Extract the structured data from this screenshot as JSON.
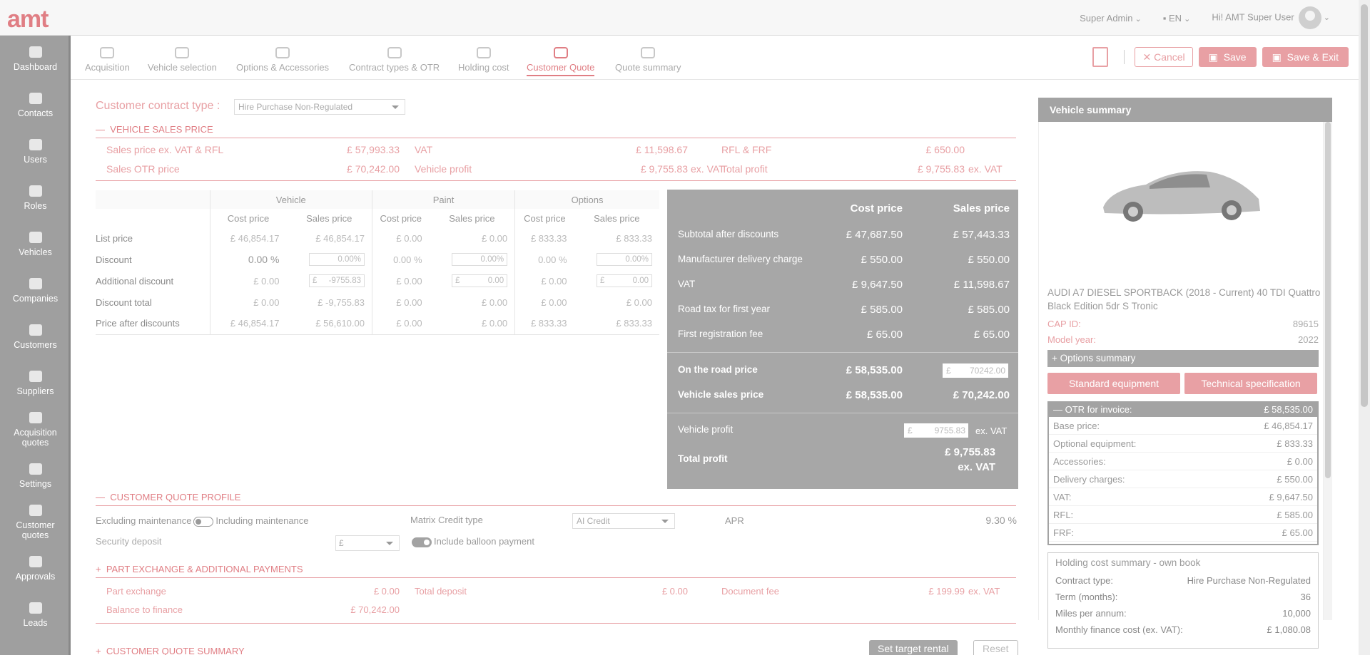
{
  "app": {
    "logo": "amt"
  },
  "topbar": {
    "role": "Super Admin",
    "lang": "EN",
    "greeting": "Hi! AMT Super User"
  },
  "sidebar": [
    {
      "label": "Dashboard",
      "icon": "dashboard-icon"
    },
    {
      "label": "Contacts",
      "icon": "contacts-icon"
    },
    {
      "label": "Users",
      "icon": "users-icon"
    },
    {
      "label": "Roles",
      "icon": "roles-icon"
    },
    {
      "label": "Vehicles",
      "icon": "car-icon"
    },
    {
      "label": "Companies",
      "icon": "companies-icon"
    },
    {
      "label": "Customers",
      "icon": "customers-icon"
    },
    {
      "label": "Suppliers",
      "icon": "suppliers-icon"
    },
    {
      "label": "Acquisition quotes",
      "icon": "acquisition-icon"
    },
    {
      "label": "Settings",
      "icon": "gear-icon"
    },
    {
      "label": "Customer quotes",
      "icon": "customer-quotes-icon"
    },
    {
      "label": "Approvals",
      "icon": "approvals-icon"
    },
    {
      "label": "Leads",
      "icon": "leads-icon"
    }
  ],
  "steps": [
    "Acquisition",
    "Vehicle selection",
    "Options & Accessories",
    "Contract types & OTR",
    "Holding cost",
    "Customer Quote",
    "Quote summary"
  ],
  "actions": {
    "cancel": "Cancel",
    "save": "Save",
    "save_exit": "Save & Exit"
  },
  "contract": {
    "label": "Customer contract type :",
    "value": "Hire Purchase Non-Regulated"
  },
  "vsp": {
    "title": "VEHICLE SALES PRICE",
    "r1": [
      [
        "Sales price ex. VAT & RFL",
        "£ 57,993.33",
        ""
      ],
      [
        "VAT",
        "£ 11,598.67",
        ""
      ],
      [
        "RFL & FRF",
        "£ 650.00",
        ""
      ]
    ],
    "r2": [
      [
        "Sales OTR price",
        "£ 70,242.00",
        ""
      ],
      [
        "Vehicle profit",
        "£ 9,755.83",
        "ex. VAT"
      ],
      [
        "Total profit",
        "£ 9,755.83",
        "ex. VAT"
      ]
    ]
  },
  "grid": {
    "groups": [
      "Vehicle",
      "Paint",
      "Options"
    ],
    "sub": [
      "Cost price",
      "Sales price",
      "Cost price",
      "Sales price",
      "Cost price",
      "Sales price"
    ],
    "list": [
      "List price",
      "£ 46,854.17",
      "£ 46,854.17",
      "£ 0.00",
      "£ 0.00",
      "£ 833.33",
      "£ 833.33"
    ],
    "disc": [
      "Discount",
      "0.00 %",
      "0.00",
      "0.00 %",
      "0.00",
      "0.00 %",
      "0.00"
    ],
    "addl": [
      "Additional discount",
      "£ 0.00",
      "-9755.83",
      "£ 0.00",
      "0.00",
      "£ 0.00",
      "0.00"
    ],
    "total": [
      "Discount total",
      "£ 0.00",
      "£ -9,755.83",
      "£ 0.00",
      "£ 0.00",
      "£ 0.00",
      "£ 0.00"
    ],
    "after": [
      "Price after discounts",
      "£ 46,854.17",
      "£ 56,610.00",
      "£ 0.00",
      "£ 0.00",
      "£ 833.33",
      "£ 833.33"
    ]
  },
  "panel": {
    "h1": "Cost price",
    "h2": "Sales price",
    "rows": [
      [
        "Subtotal after discounts",
        "£ 47,687.50",
        "£ 57,443.33"
      ],
      [
        "Manufacturer delivery charge",
        "£ 550.00",
        "£ 550.00"
      ],
      [
        "VAT",
        "£ 9,647.50",
        "£ 11,598.67"
      ],
      [
        "Road tax for first year",
        "£ 585.00",
        "£ 585.00"
      ],
      [
        "First registration fee",
        "£ 65.00",
        "£ 65.00"
      ]
    ],
    "otr": [
      "On the road price",
      "£ 58,535.00",
      "70242.00"
    ],
    "vsp": [
      "Vehicle sales price",
      "£ 58,535.00",
      "£ 70,242.00"
    ],
    "vprofit": [
      "Vehicle profit",
      "9755.83",
      "ex. VAT"
    ],
    "tprofit": [
      "Total profit",
      "£ 9,755.83",
      "ex. VAT"
    ]
  },
  "cqp": {
    "title": "CUSTOMER QUOTE PROFILE",
    "excl": "Excluding maintenance",
    "incl": "Including maintenance",
    "matrix_label": "Matrix Credit type",
    "matrix_value": "AI Credit",
    "apr_label": "APR",
    "apr_value": "9.30 %",
    "deposit_label": "Security deposit",
    "balloon": "Include balloon payment"
  },
  "pe": {
    "title": "PART EXCHANGE & ADDITIONAL PAYMENTS",
    "r1": [
      [
        "Part exchange",
        "£ 0.00",
        ""
      ],
      [
        "Total deposit",
        "£ 0.00",
        ""
      ],
      [
        "Document fee",
        "£ 199.99",
        "ex. VAT"
      ]
    ],
    "r2": [
      [
        "Balance to finance",
        "£ 70,242.00",
        ""
      ]
    ]
  },
  "cqs": {
    "title": "CUSTOMER QUOTE SUMMARY",
    "target": "Set target rental",
    "reset": "Reset"
  },
  "vehicle": {
    "header": "Vehicle summary",
    "name": "AUDI A7 DIESEL SPORTBACK (2018 - Current) 40 TDI Quattro Black Edition 5dr S Tronic",
    "cap_label": "CAP ID:",
    "cap": "89615",
    "my_label": "Model year:",
    "my": "2022",
    "options": "Options summary",
    "std": "Standard equipment",
    "tech": "Technical specification",
    "otr_label": "OTR for invoice:",
    "otr_value": "£ 58,535.00",
    "otr_rows": [
      [
        "Base price:",
        "£ 46,854.17"
      ],
      [
        "Optional equipment:",
        "£ 833.33"
      ],
      [
        "Accessories:",
        "£ 0.00"
      ],
      [
        "Delivery charges:",
        "£ 550.00"
      ],
      [
        "VAT:",
        "£ 9,647.50"
      ],
      [
        "RFL:",
        "£ 585.00"
      ],
      [
        "FRF:",
        "£ 65.00"
      ]
    ],
    "hc_title": "Holding cost summary - own book",
    "hc_rows": [
      [
        "Contract type:",
        "Hire Purchase Non-Regulated"
      ],
      [
        "Term (months):",
        "36"
      ],
      [
        "Miles per annum:",
        "10,000"
      ],
      [
        "Monthly finance cost (ex. VAT):",
        "£ 1,080.08"
      ]
    ]
  }
}
